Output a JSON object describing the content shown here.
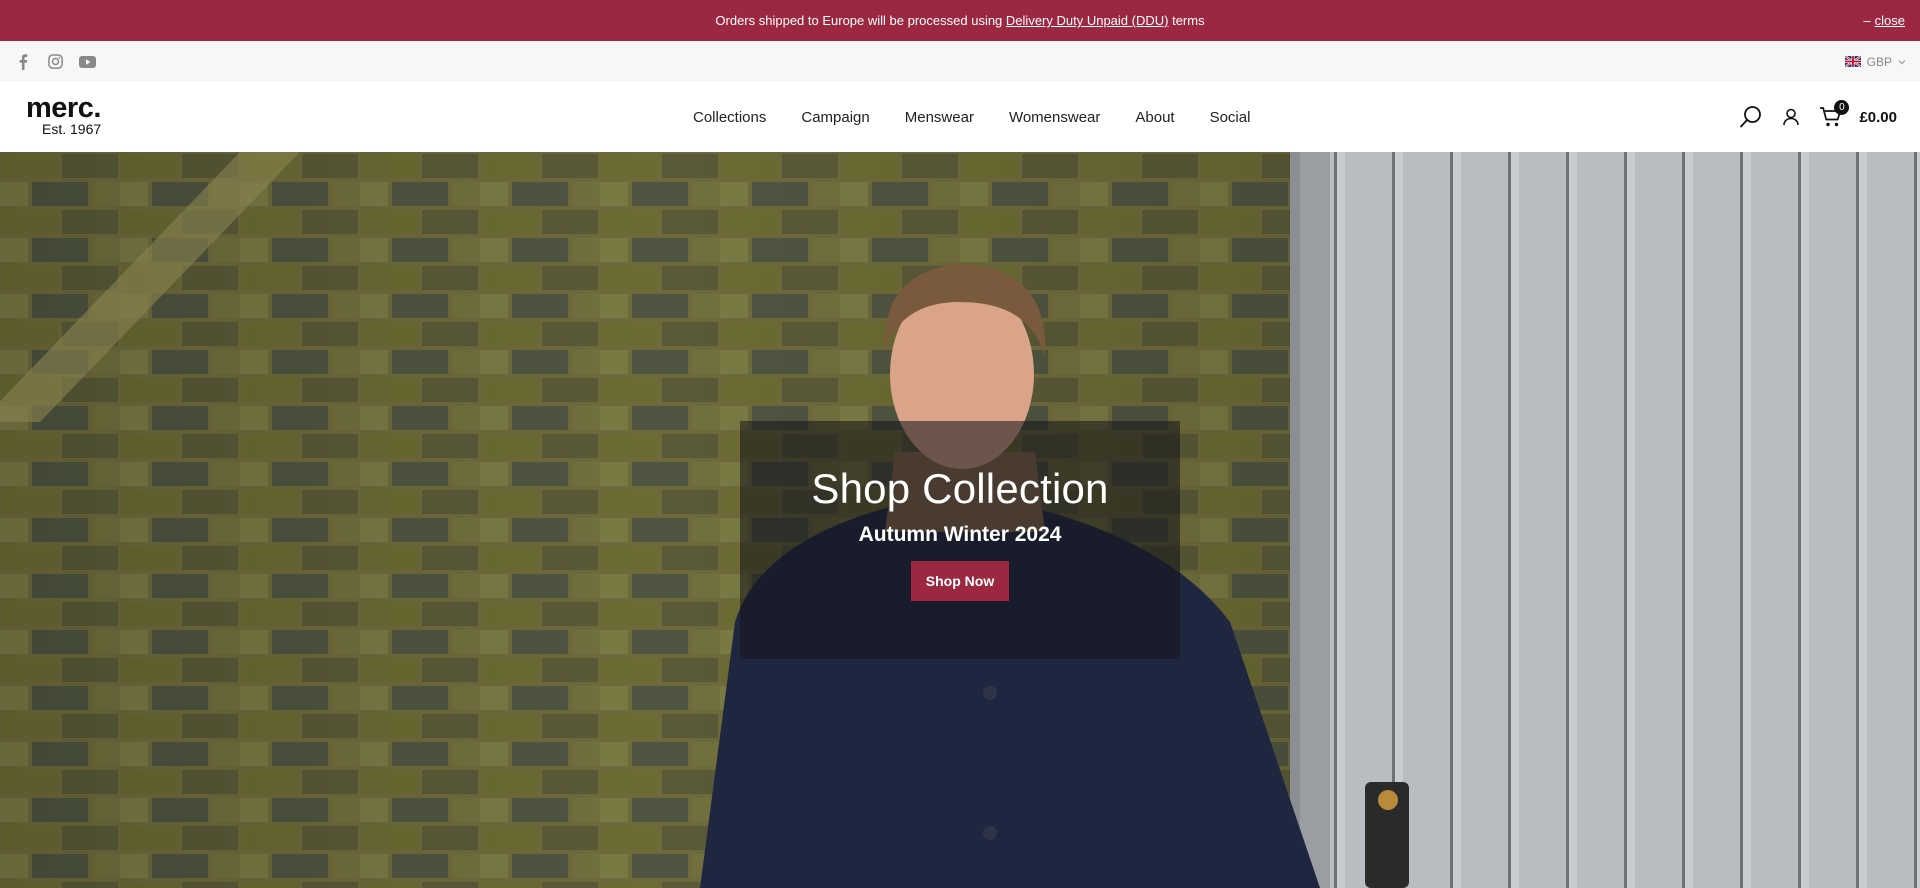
{
  "announcement": {
    "text_before": "Orders shipped to Europe will be processed using",
    "link_text": "Delivery Duty Unpaid (DDU)",
    "text_after": "terms",
    "close_prefix": "–",
    "close_label": "close"
  },
  "utility": {
    "socials": [
      "facebook-icon",
      "instagram-icon",
      "youtube-icon"
    ],
    "currency": "GBP"
  },
  "header": {
    "logo_word": "merc.",
    "logo_tagline": "Est. 1967",
    "nav": [
      "Collections",
      "Campaign",
      "Menswear",
      "Womenswear",
      "About",
      "Social"
    ],
    "cart_count": "0",
    "cart_total": "£0.00"
  },
  "hero": {
    "title": "Shop Collection",
    "subtitle": "Autumn Winter 2024",
    "cta": "Shop Now"
  },
  "colors": {
    "brand": "#9b2740",
    "utility_bg": "#f7f7f8"
  }
}
